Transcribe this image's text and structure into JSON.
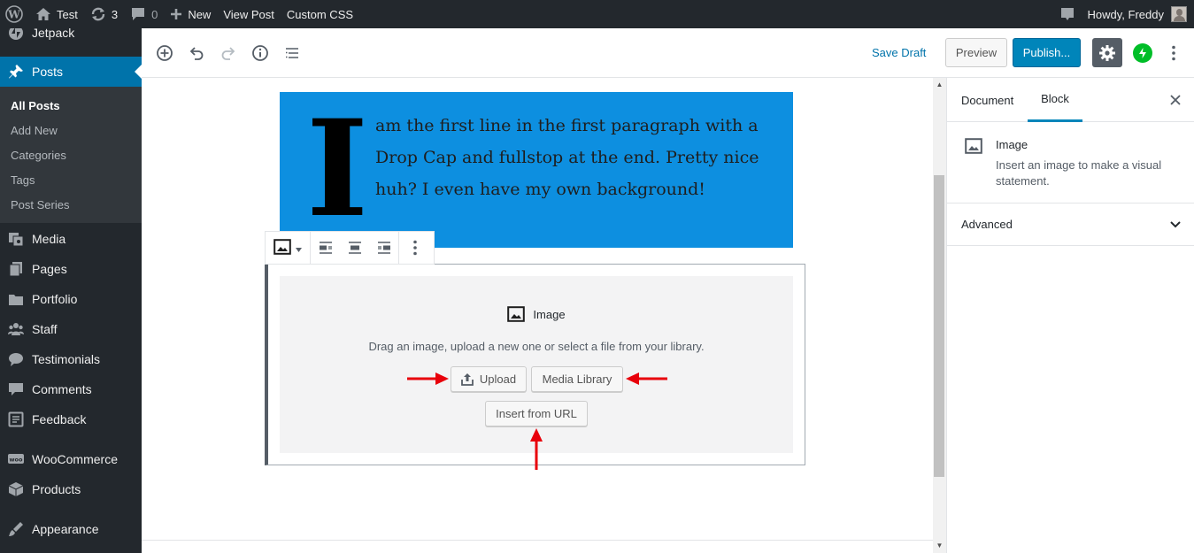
{
  "admin_bar": {
    "site_name": "Test",
    "updates_count": "3",
    "comments_count": "0",
    "new_label": "New",
    "view_post_label": "View Post",
    "custom_css_label": "Custom CSS",
    "greeting": "Howdy, Freddy"
  },
  "sidebar": {
    "items": [
      {
        "label": "Jetpack",
        "icon": "jetpack-icon"
      },
      {
        "label": "Posts",
        "icon": "pin-icon",
        "active": true
      },
      {
        "label": "Media",
        "icon": "media-icon"
      },
      {
        "label": "Pages",
        "icon": "pages-icon"
      },
      {
        "label": "Portfolio",
        "icon": "portfolio-icon"
      },
      {
        "label": "Staff",
        "icon": "staff-icon"
      },
      {
        "label": "Testimonials",
        "icon": "testimonials-icon"
      },
      {
        "label": "Comments",
        "icon": "comments-icon"
      },
      {
        "label": "Feedback",
        "icon": "feedback-icon"
      },
      {
        "label": "WooCommerce",
        "icon": "woocommerce-icon"
      },
      {
        "label": "Products",
        "icon": "products-icon"
      },
      {
        "label": "Appearance",
        "icon": "appearance-icon"
      }
    ],
    "posts_submenu": [
      "All Posts",
      "Add New",
      "Categories",
      "Tags",
      "Post Series"
    ]
  },
  "header": {
    "save_draft": "Save Draft",
    "preview": "Preview",
    "publish": "Publish..."
  },
  "content": {
    "dropcap": "I",
    "paragraph": "am the first line in the first paragraph with a Drop Cap and fullstop at the end. Pretty nice huh? I even have my own background!",
    "paragraph_bg": "#0d8fe0",
    "image_block": {
      "label": "Image",
      "instructions": "Drag an image, upload a new one or select a file from your library.",
      "upload": "Upload",
      "media_library": "Media Library",
      "insert_url": "Insert from URL"
    }
  },
  "settings": {
    "tab_document": "Document",
    "tab_block": "Block",
    "block_title": "Image",
    "block_description": "Insert an image to make a visual statement.",
    "advanced": "Advanced"
  },
  "colors": {
    "accent": "#0073aa",
    "publish": "#0085ba",
    "annotation_arrow": "#e8000b",
    "jetpack": "#00be28"
  }
}
